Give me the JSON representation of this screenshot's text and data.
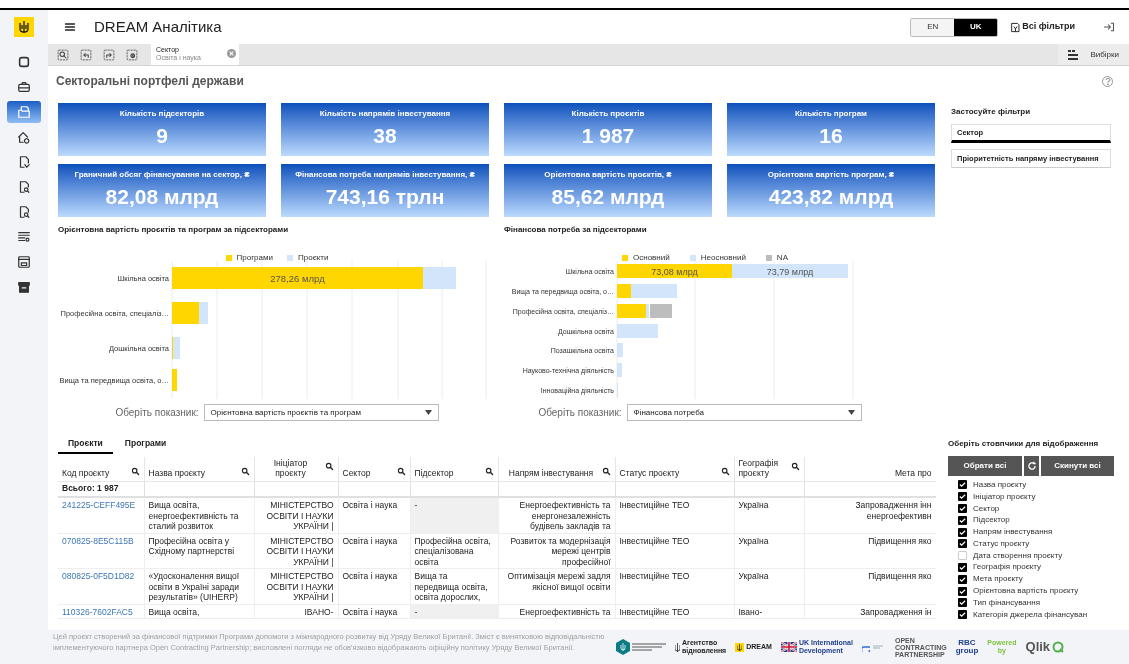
{
  "header": {
    "title": "DREAM Аналітика",
    "languages": [
      {
        "label": "EN",
        "selected": false
      },
      {
        "label": "UK",
        "selected": true
      }
    ],
    "all_filters": "Всі фільтри"
  },
  "sidebar": {
    "items": [
      {
        "selected": false
      },
      {
        "selected": false
      },
      {
        "selected": true
      },
      {
        "selected": false
      },
      {
        "selected": false
      },
      {
        "selected": false
      },
      {
        "selected": false
      },
      {
        "selected": false
      },
      {
        "selected": false
      },
      {
        "selected": false
      }
    ]
  },
  "toolbar": {
    "selection": {
      "field": "Сектор",
      "value": "Освіта і наука"
    },
    "selections_button": "Вибірки"
  },
  "page_title": "Секторальні портфелі держави",
  "kpis": [
    {
      "title": "Кількість підсекторів",
      "value": "9"
    },
    {
      "title": "Кількість напрямів інвестування",
      "value": "38"
    },
    {
      "title": "Кількість проєктів",
      "value": "1 987"
    },
    {
      "title": "Кількість програм",
      "value": "16"
    },
    {
      "title": "Граничний обсяг фінансування на сектор, ₴",
      "value": "82,08 млрд"
    },
    {
      "title": "Фінансова потреба напрямів інвестування, ₴",
      "value": "743,16 трлн"
    },
    {
      "title": "Орієнтовна вартість проєктів, ₴",
      "value": "85,62 млрд"
    },
    {
      "title": "Орієнтовна вартість програм, ₴",
      "value": "423,82 млрд"
    }
  ],
  "filters": {
    "title": "Застосуйте фільтри",
    "items": [
      {
        "label": "Сектор",
        "selected": true
      },
      {
        "label": "Пріоритетність напряму інвестування",
        "selected": false
      }
    ]
  },
  "charts": [
    {
      "title": "Орієнтовна вартість проєктів та програм за підсекторами",
      "legend": [
        {
          "name": "Програми",
          "color": "#ffd600"
        },
        {
          "name": "Проєкти",
          "color": "#d3e5fb"
        }
      ],
      "rows": [
        {
          "label": "Шкільна освіта",
          "bar_labels": [
            "278,26 млрд"
          ]
        },
        {
          "label": "Професійна освіта, спеціаліз…"
        },
        {
          "label": "Дошкільна освіта"
        },
        {
          "label": "Вища та передвища освіта, о…"
        }
      ],
      "picker_label": "Оберіть показник:",
      "picker_value": "Орієнтовна вартість проєктів та програм"
    },
    {
      "title": "Фінансова потреба за підсекторами",
      "legend": [
        {
          "name": "Основний",
          "color": "#ffd600"
        },
        {
          "name": "Неосновний",
          "color": "#d3e5fb"
        },
        {
          "name": "NA",
          "color": "#bdbdbd"
        }
      ],
      "rows": [
        {
          "label": "Шкільна освіта",
          "bar_labels": [
            "73,08 млрд",
            "73,79 млрд"
          ]
        },
        {
          "label": "Вища та передвища освіта, о…"
        },
        {
          "label": "Професійна освіта, спеціаліз…"
        },
        {
          "label": "Дошкільна освіта"
        },
        {
          "label": "Позашкільна освіта"
        },
        {
          "label": "Науково-технічна діяльність"
        },
        {
          "label": "Інноваційна діяльність"
        }
      ],
      "picker_label": "Оберіть показник:",
      "picker_value": "Фінансова потреба"
    }
  ],
  "table": {
    "tabs": [
      {
        "label": "Проєкти",
        "selected": true
      },
      {
        "label": "Програми",
        "selected": false
      }
    ],
    "columns": [
      {
        "label": "Код проєкту",
        "searchable": true
      },
      {
        "label": "Назва проєкту",
        "searchable": true
      },
      {
        "label": "Ініціатор проєкту",
        "searchable": true
      },
      {
        "label": "Сектор",
        "searchable": true
      },
      {
        "label": "Підсектор",
        "searchable": true
      },
      {
        "label": "Напрям інвестування",
        "searchable": true
      },
      {
        "label": "Статус проєкту",
        "searchable": true
      },
      {
        "label": "Географія проєкту",
        "searchable": true
      },
      {
        "label": "Мета про",
        "searchable": false
      }
    ],
    "total": "Всього: 1 987",
    "rows": [
      {
        "subsector_blank": true,
        "cells": [
          "241225-CEFF495E",
          "Вища освіта, енергоефективність та сталий розвиток",
          "МІНІСТЕРСТВО ОСВІТИ І НАУКИ УКРАЇНИ |",
          "Освіта і наука",
          "-",
          "Енергоефективність та енергонезалежність будівель закладів та",
          "Інвестиційне ТЕО",
          "Україна",
          "Запровадження інн енергоефективн"
        ]
      },
      {
        "subsector_blank": false,
        "cells": [
          "070825-8E5C115B",
          "Професійна освіта у Східному партнерстві",
          "МІНІСТЕРСТВО ОСВІТИ І НАУКИ УКРАЇНИ |",
          "Освіта і наука",
          "Професійна освіта, спеціалізована освіта",
          "Розвиток та модернізація мережі центрів професійної",
          "Інвестиційне ТЕО",
          "Україна",
          "Підвищення яко"
        ]
      },
      {
        "subsector_blank": false,
        "cells": [
          "080825-0F5D1D82",
          "«Удосконалення вищої освіти в Україні заради результатів» (UIHERP)",
          "МІНІСТЕРСТВО ОСВІТИ І НАУКИ УКРАЇНИ |",
          "Освіта і наука",
          "Вища та передвища освіта, освіта дорослих,",
          "Оптимізація мережі задля якісної вищої освіти",
          "Інвестиційне ТЕО",
          "Україна",
          "Підвищення яко"
        ]
      },
      {
        "subsector_blank": true,
        "cells": [
          "110326-7602FAC5",
          "Вища освіта,",
          "ІВАНО-",
          "Освіта і наука",
          "-",
          "Енергоефективність та",
          "Інвестиційне ТЕО",
          "Івано-",
          "Запровадження ін"
        ]
      }
    ]
  },
  "column_picker": {
    "title": "Оберіть стовпчики для відображення",
    "select_all": "Обрати всі",
    "reset_all": "Скинути всі",
    "items": [
      {
        "label": "Назва проєкту",
        "checked": true
      },
      {
        "label": "Ініціатор проєкту",
        "checked": true
      },
      {
        "label": "Сектор",
        "checked": true
      },
      {
        "label": "Підсектор",
        "checked": true
      },
      {
        "label": "Напрям інвестування",
        "checked": true
      },
      {
        "label": "Статус проєкту",
        "checked": true
      },
      {
        "label": "Дата створення проєкту",
        "checked": false
      },
      {
        "label": "Географія проєкту",
        "checked": true
      },
      {
        "label": "Мета проєкту",
        "checked": true
      },
      {
        "label": "Орієнтовна вартість проєкту",
        "checked": true
      },
      {
        "label": "Тип фінансування",
        "checked": true
      },
      {
        "label": "Категорія джерела фінансуван",
        "checked": true
      }
    ]
  },
  "footer": {
    "text": "Цей проєкт створений за фінансової підтримки Програми допомоги з міжнародного розвитку від Уряду Великої Британії. Зміст є винятковою відповідальністю імплементуючого партнера Open Contracting Partnership; висловлені погляди не обов'язково відображають офіційну політику Уряду Великої Британії.",
    "logos": [
      {
        "kind": "ministry"
      },
      {
        "kind": "agency",
        "lines": [
          "Агентство",
          "відновлення"
        ]
      },
      {
        "kind": "dream",
        "lines": [
          "DREAM"
        ]
      },
      {
        "kind": "ukid",
        "lines": [
          "UK International",
          "Development"
        ]
      },
      {
        "kind": "e"
      },
      {
        "kind": "ocp",
        "lines": [
          "OPEN",
          "CONTRACTING",
          "PARTNERSHIP"
        ]
      },
      {
        "kind": "rbc",
        "lines": [
          "RBC",
          "group"
        ]
      },
      {
        "kind": "powered",
        "lines": [
          "Powered",
          "by"
        ]
      },
      {
        "kind": "qlik",
        "lines": [
          "Qlik"
        ]
      }
    ]
  }
}
